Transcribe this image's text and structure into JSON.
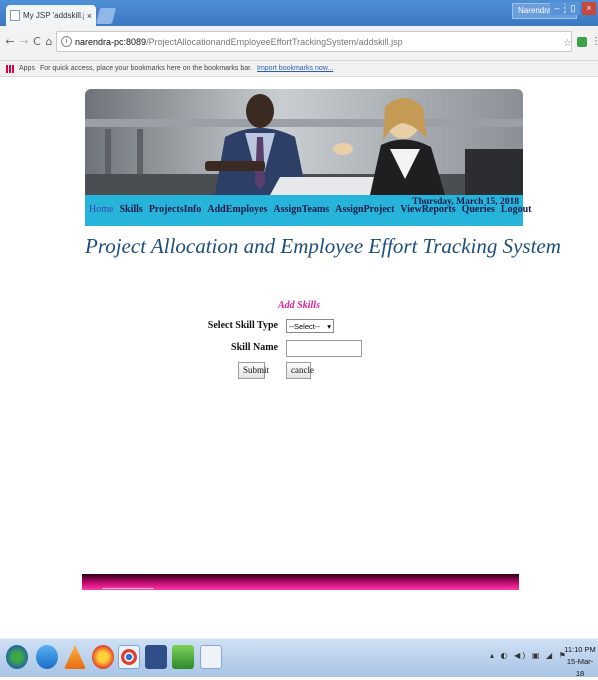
{
  "browser": {
    "tab_title": "My JSP 'addskill.jsp' star",
    "tab_close": "×",
    "user_name": "Narendra MCA",
    "win_min": "–",
    "win_max": "▯",
    "win_close": "×",
    "back": "←",
    "forward": "→",
    "reload": "C",
    "home": "⌂",
    "url_host": "narendra-pc:8089",
    "url_path": "/ProjectAllocationandEmployeeEffortTrackingSystem/addskill.jsp",
    "star": "☆",
    "menu": "⋮",
    "bookmarks_apps": "Apps",
    "bookmarks_hint": "For quick access, place your bookmarks here on the bookmarks bar.",
    "bookmarks_import": "Import bookmarks now..."
  },
  "nav": {
    "items": [
      {
        "label": "Home"
      },
      {
        "label": "Skills"
      },
      {
        "label": "ProjectsInfo"
      },
      {
        "label": "AddEmployes"
      },
      {
        "label": "AssignTeams"
      },
      {
        "label": "AssignProject"
      },
      {
        "label": "ViewReports"
      },
      {
        "label": "Queries"
      },
      {
        "label": "Logout"
      }
    ],
    "date": "Thursday, March 15, 2018"
  },
  "page": {
    "headline": "Project Allocation and Employee Effort Tracking System"
  },
  "form": {
    "title": "Add Skills",
    "skill_type_label": "Select Skill Type",
    "skill_type_value": "--Select--",
    "skill_type_arrow": "▾",
    "skill_name_label": "Skill Name",
    "skill_name_value": "",
    "submit_label": "Submit",
    "cancel_label": "cancle"
  },
  "taskbar": {
    "tray": "▴ ◐ ◀) ▣ ◢ ⚑",
    "time": "11:10 PM",
    "date": "15-Mar-18"
  },
  "colors": {
    "navbar": "#27b4da",
    "headline": "#1d4d7c",
    "form_title": "#e0209a",
    "footer": "#c20a72"
  }
}
